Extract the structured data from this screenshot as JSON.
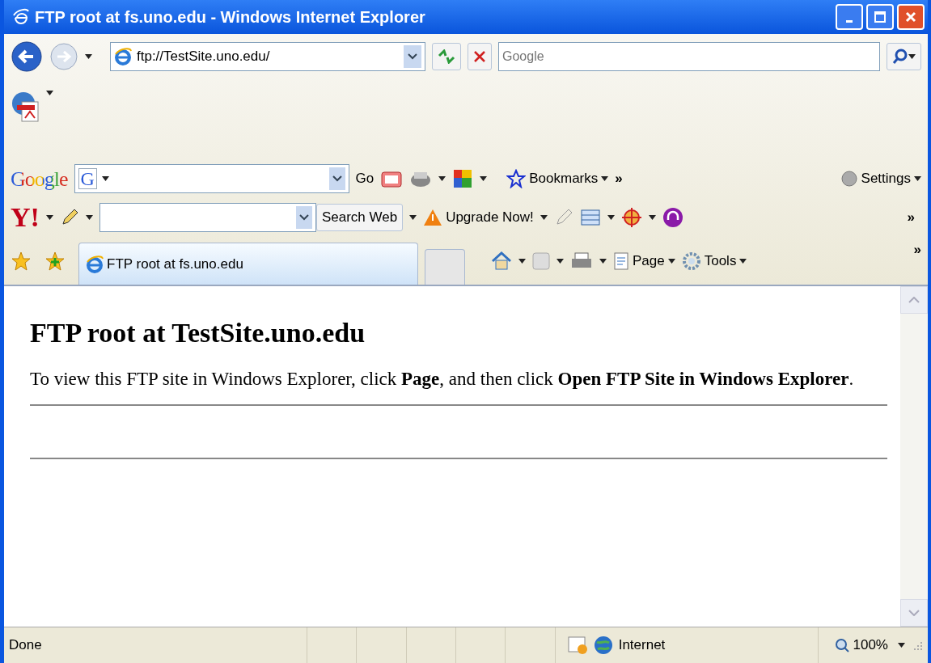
{
  "window": {
    "title": "FTP root at fs.uno.edu - Windows Internet Explorer"
  },
  "address_bar": {
    "url": "ftp://TestSite.uno.edu/"
  },
  "search_box": {
    "placeholder": "Google"
  },
  "google_toolbar": {
    "logo": "Google",
    "engine_letter": "G",
    "go": "Go",
    "bookmarks": "Bookmarks",
    "more": "»",
    "settings": "Settings"
  },
  "yahoo_toolbar": {
    "logo": "Y!",
    "search_button": "Search Web",
    "upgrade": "Upgrade Now!",
    "more": "»"
  },
  "tabs": [
    {
      "label": "FTP root at fs.uno.edu",
      "selected": true
    }
  ],
  "command_bar": {
    "page": "Page",
    "tools": "Tools",
    "more": "»"
  },
  "content": {
    "heading": "FTP root at TestSite.uno.edu",
    "text": "To view this FTP site in Windows Explorer, click **Page**, and then click **Open FTP Site in Windows Explorer**."
  },
  "status_bar": {
    "status": "Done",
    "zone": "Internet",
    "zoom": "100%"
  }
}
